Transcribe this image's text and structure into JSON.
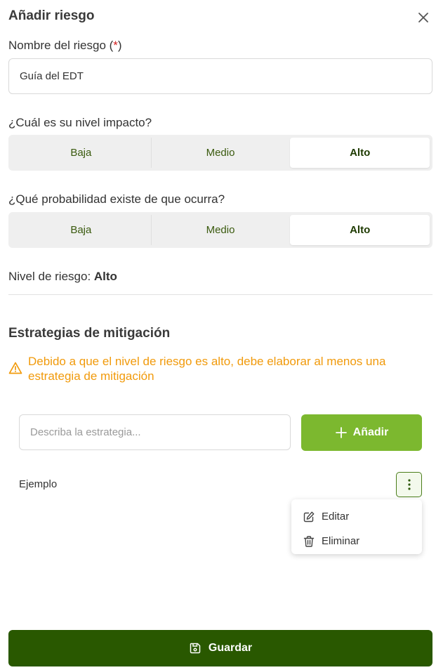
{
  "dialog": {
    "title": "Añadir riesgo",
    "close_icon": "close-icon"
  },
  "risk_name": {
    "label": "Nombre del riesgo (",
    "required_mark": "*",
    "label_end": ")",
    "value": "Guía del EDT"
  },
  "impact": {
    "question": "¿Cuál es su nivel impacto?",
    "options": [
      "Baja",
      "Medio",
      "Alto"
    ],
    "selected": "Alto"
  },
  "probability": {
    "question": "¿Qué probabilidad existe de que ocurra?",
    "options": [
      "Baja",
      "Medio",
      "Alto"
    ],
    "selected": "Alto"
  },
  "risk_level": {
    "label": "Nivel de riesgo: ",
    "value": "Alto"
  },
  "mitigation": {
    "title": "Estrategias de mitigación",
    "warning": "Debido a que el nivel de riesgo es alto, debe elaborar al menos una estrategia de mitigación",
    "warning_color": "#f19a0b",
    "input_placeholder": "Describa la estrategia...",
    "input_value": "",
    "add_label": "Añadir",
    "items": [
      {
        "text": "Ejemplo"
      }
    ],
    "menu": {
      "edit_label": "Editar",
      "delete_label": "Eliminar"
    }
  },
  "footer": {
    "save_label": "Guardar"
  },
  "colors": {
    "accent_green": "#7cb82f",
    "dark_green": "#295800",
    "required_red": "#d21f1f"
  }
}
